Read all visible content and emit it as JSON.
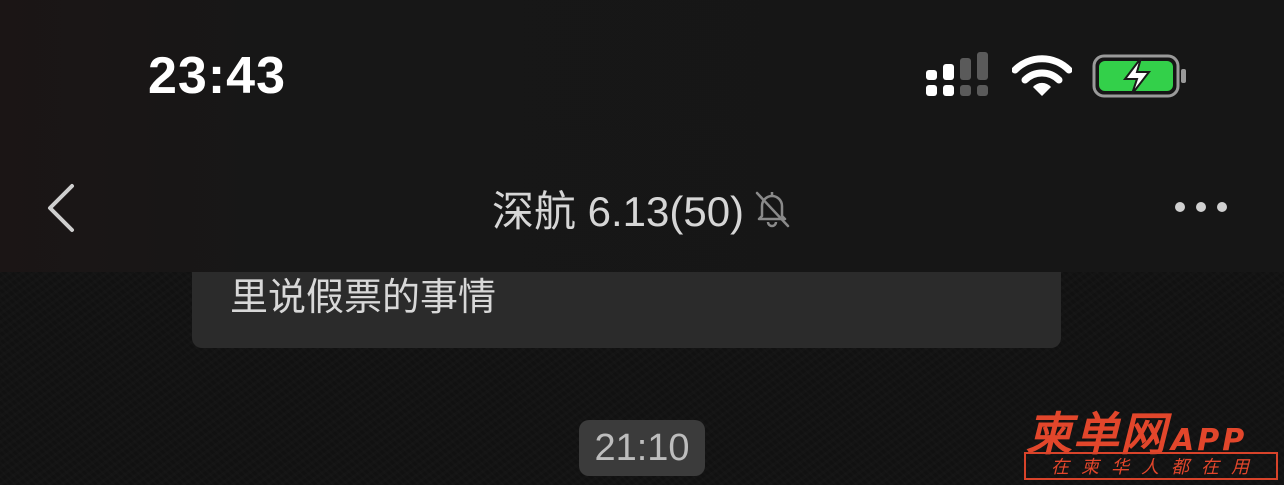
{
  "status_bar": {
    "time": "23:43",
    "signal_icon": "signal-bars-icon",
    "wifi_icon": "wifi-icon",
    "battery_icon": "battery-charging-icon",
    "battery_color": "#33d04a"
  },
  "nav": {
    "back_icon": "chevron-left-icon",
    "title": "深航 6.13(50)",
    "mute_icon": "bell-slash-icon",
    "more_icon": "more-dots-icon"
  },
  "messages": [
    {
      "type": "text",
      "text": "里说假票的事情"
    }
  ],
  "timestamp": "21:10",
  "watermark": {
    "brand": "柬单网",
    "app": "APP",
    "slogan": "在柬华人都在用",
    "color": "#e2462b"
  }
}
